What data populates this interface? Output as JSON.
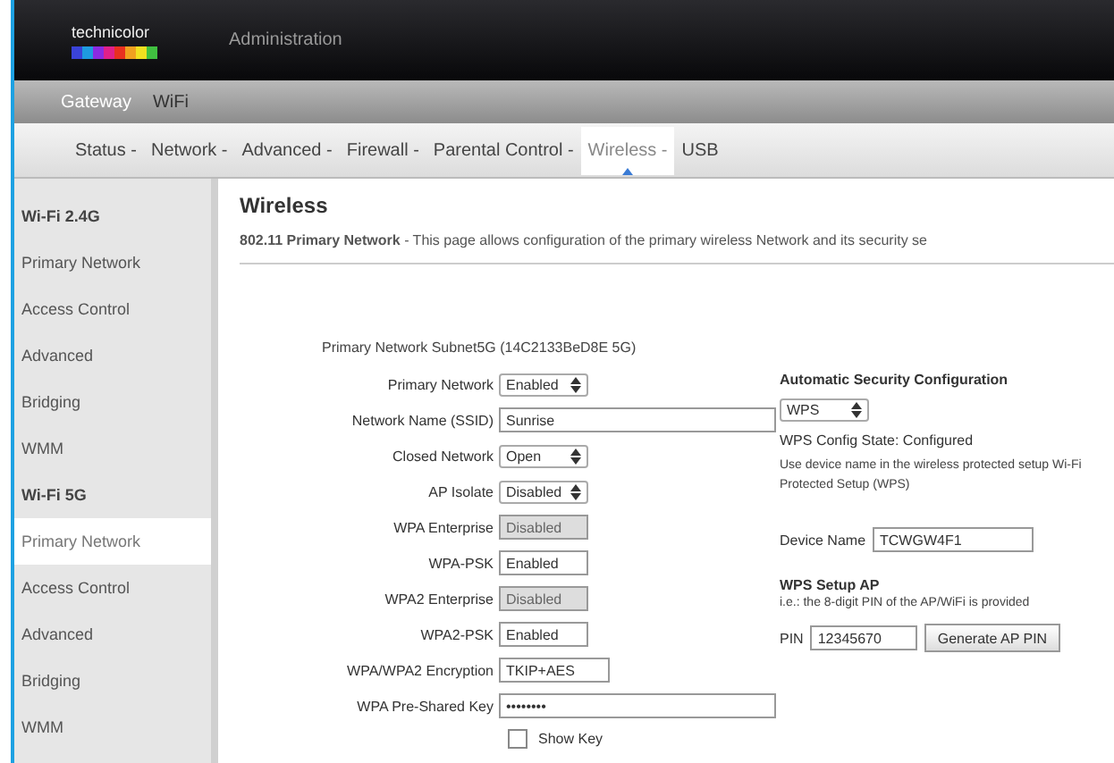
{
  "header": {
    "logo": "technicolor",
    "title": "Administration"
  },
  "breadcrumb": [
    "Gateway",
    "WiFi"
  ],
  "nav": [
    {
      "label": "Status -",
      "selected": false
    },
    {
      "label": "Network -",
      "selected": false
    },
    {
      "label": "Advanced -",
      "selected": false
    },
    {
      "label": "Firewall -",
      "selected": false
    },
    {
      "label": "Parental Control -",
      "selected": false
    },
    {
      "label": "Wireless -",
      "selected": true
    },
    {
      "label": "USB",
      "selected": false
    }
  ],
  "sidebar": [
    {
      "label": "Wi-Fi 2.4G",
      "kind": "heading",
      "selected": false
    },
    {
      "label": "Primary Network",
      "kind": "item",
      "selected": false
    },
    {
      "label": "Access Control",
      "kind": "item",
      "selected": false
    },
    {
      "label": "Advanced",
      "kind": "item",
      "selected": false
    },
    {
      "label": "Bridging",
      "kind": "item",
      "selected": false
    },
    {
      "label": "WMM",
      "kind": "item",
      "selected": false
    },
    {
      "label": "Wi-Fi 5G",
      "kind": "heading",
      "selected": false
    },
    {
      "label": "Primary Network",
      "kind": "item",
      "selected": true
    },
    {
      "label": "Access Control",
      "kind": "item",
      "selected": false
    },
    {
      "label": "Advanced",
      "kind": "item",
      "selected": false
    },
    {
      "label": "Bridging",
      "kind": "item",
      "selected": false
    },
    {
      "label": "WMM",
      "kind": "item",
      "selected": false
    }
  ],
  "page": {
    "title": "Wireless",
    "intro": "**802.11 Primary Network** - This page allows configuration of the primary wireless Network and its security se"
  },
  "form": {
    "subnet": "Primary Network Subnet5G (14C2133BeD8E 5G)",
    "fields": [
      {
        "label": "Primary Network",
        "kind": "select",
        "value": "Enabled",
        "disabled": false
      },
      {
        "label": "Network Name (SSID)",
        "kind": "text",
        "value": "Sunrise",
        "disabled": false
      },
      {
        "label": "Closed Network",
        "kind": "select",
        "value": "Open",
        "disabled": false
      },
      {
        "label": "AP Isolate",
        "kind": "select",
        "value": "Disabled",
        "disabled": false
      },
      {
        "label": "WPA Enterprise",
        "kind": "short",
        "value": "Disabled",
        "disabled": true
      },
      {
        "label": "WPA-PSK",
        "kind": "short",
        "value": "Enabled",
        "disabled": false
      },
      {
        "label": "WPA2 Enterprise",
        "kind": "short",
        "value": "Disabled",
        "disabled": true
      },
      {
        "label": "WPA2-PSK",
        "kind": "short",
        "value": "Enabled",
        "disabled": false
      },
      {
        "label": "WPA/WPA2 Encryption",
        "kind": "medium",
        "value": "TKIP+AES",
        "disabled": false
      },
      {
        "label": "WPA Pre-Shared Key",
        "kind": "text",
        "value": "••••••••",
        "disabled": false
      }
    ],
    "show_key": {
      "label": "Show Key",
      "checked": false
    }
  },
  "security": {
    "title": "Automatic Security Configuration",
    "mode": "WPS",
    "state": "WPS Config State: Configured",
    "note": "Use device name in the wireless protected setup Wi-Fi Protected Setup (WPS)",
    "device_name": {
      "label": "Device Name",
      "value": "TCWGW4F1"
    },
    "setup": {
      "title": "WPS Setup AP",
      "note": "i.e.: the 8-digit PIN of the AP/WiFi is provided",
      "pin": {
        "label": "PIN",
        "value": "12345670"
      },
      "button": "Generate AP PIN"
    }
  }
}
